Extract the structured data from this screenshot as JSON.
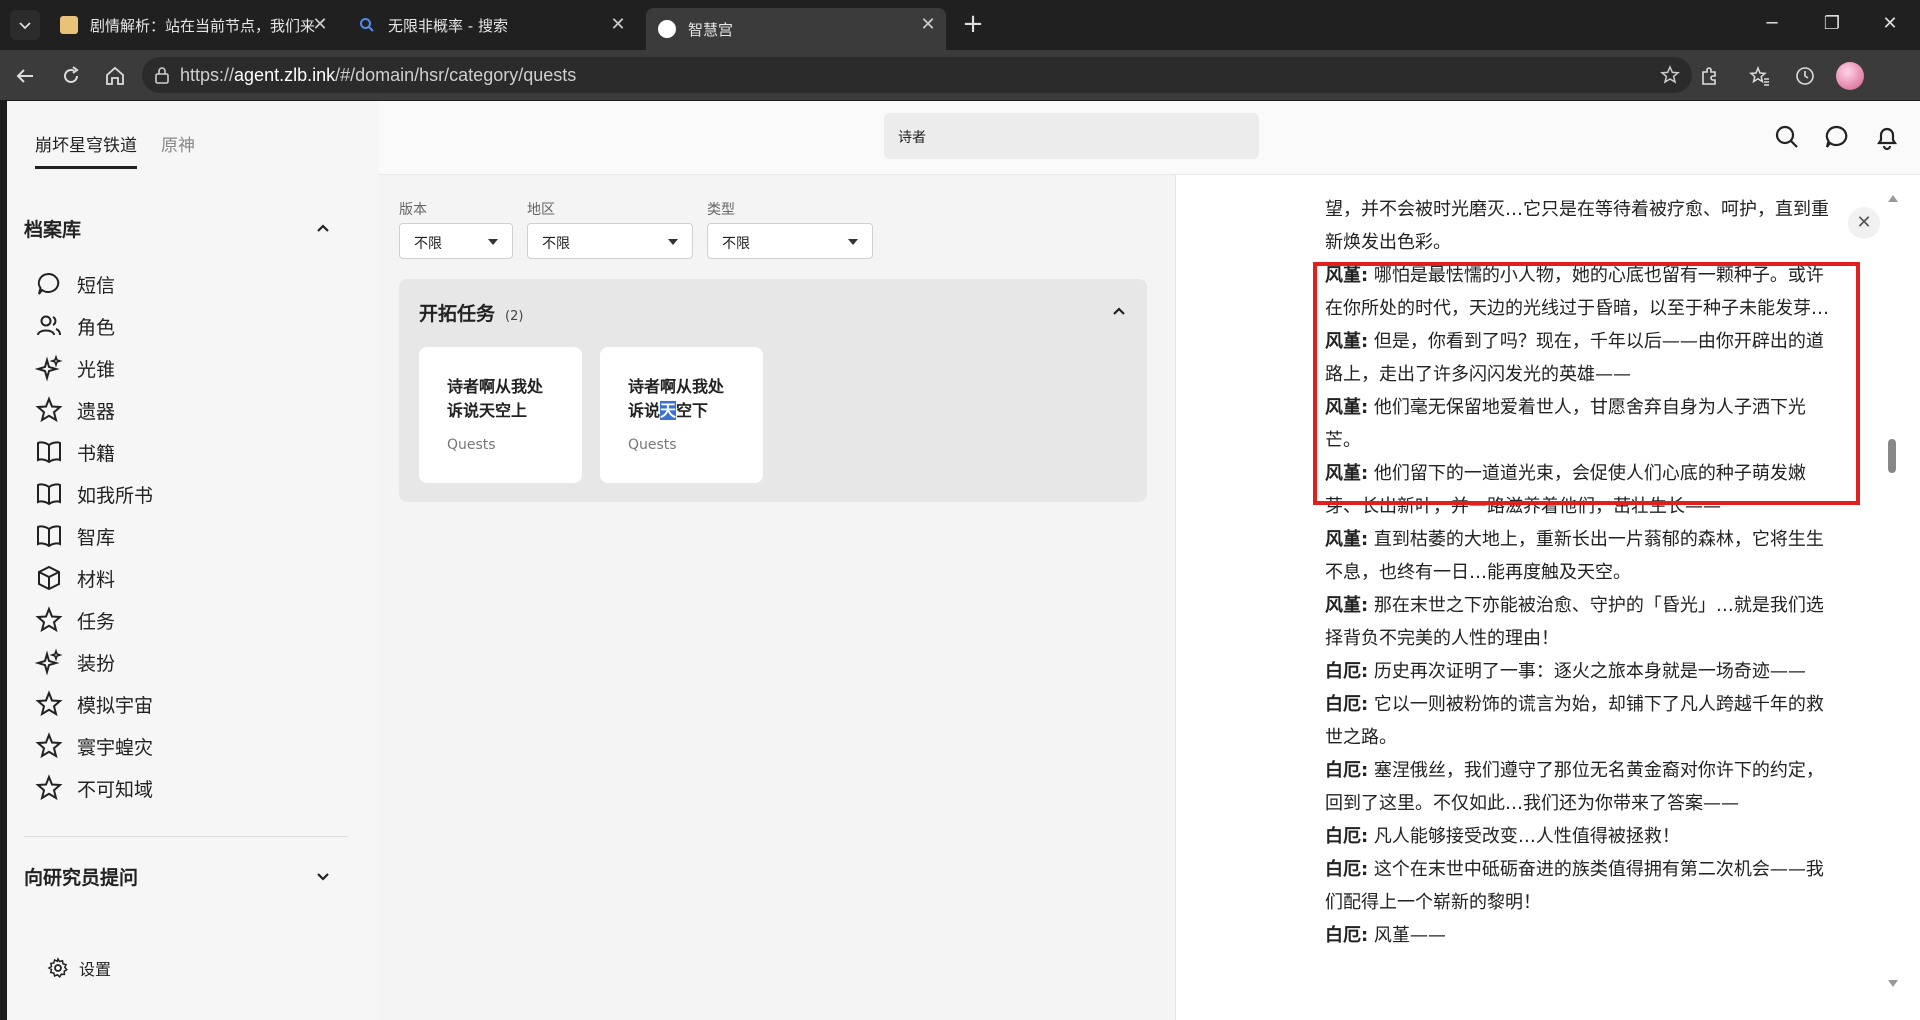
{
  "browser": {
    "tabs": [
      {
        "title": "剧情解析：站在当前节点，我们来",
        "active": false
      },
      {
        "title": "无限非概率 - 搜索",
        "active": false
      },
      {
        "title": "智慧宫",
        "active": true
      }
    ],
    "url_prefix": "https://",
    "url_host": "agent.zlb.ink",
    "url_path": "/#/domain/hsr/category/quests"
  },
  "sidebar": {
    "game_tabs": [
      "崩坏星穹铁道",
      "原神"
    ],
    "archive_title": "档案库",
    "items": [
      {
        "label": "短信",
        "icon": "message-icon"
      },
      {
        "label": "角色",
        "icon": "users-icon"
      },
      {
        "label": "光锥",
        "icon": "sparkles-icon"
      },
      {
        "label": "遗器",
        "icon": "star-icon"
      },
      {
        "label": "书籍",
        "icon": "book-icon"
      },
      {
        "label": "如我所书",
        "icon": "book-icon"
      },
      {
        "label": "智库",
        "icon": "book-icon"
      },
      {
        "label": "材料",
        "icon": "box-icon"
      },
      {
        "label": "任务",
        "icon": "star-icon"
      },
      {
        "label": "装扮",
        "icon": "sparkles-icon"
      },
      {
        "label": "模拟宇宙",
        "icon": "star-icon"
      },
      {
        "label": "寰宇蝗灾",
        "icon": "star-icon"
      },
      {
        "label": "不可知域",
        "icon": "star-icon"
      }
    ],
    "ask_title": "向研究员提问",
    "settings_label": "设置"
  },
  "topbar": {
    "search_value": "诗者"
  },
  "filters": [
    {
      "label": "版本",
      "value": "不限"
    },
    {
      "label": "地区",
      "value": "不限"
    },
    {
      "label": "类型",
      "value": "不限"
    }
  ],
  "panel": {
    "title": "开拓任务",
    "count": "(2)",
    "cards": [
      {
        "title": "诗者啊从我处诉说天空上",
        "sub": "Quests"
      },
      {
        "title_a": "诗者啊从我处诉说",
        "title_hl": "天",
        "title_b": "空下",
        "sub": "Quests"
      }
    ]
  },
  "reader": {
    "lines": [
      {
        "speaker": "",
        "text": "望，并不会被时光磨灭…它只是在等待着被疗愈、呵护，直到重新焕发出色彩。"
      },
      {
        "speaker": "风堇:",
        "text": " 哪怕是最怯懦的小人物，她的心底也留有一颗种子。或许在你所处的时代，天边的光线过于昏暗，以至于种子未能发芽…"
      },
      {
        "speaker": "风堇:",
        "text": " 但是，你看到了吗？现在，千年以后——由你开辟出的道路上，走出了许多闪闪发光的英雄——"
      },
      {
        "speaker": "风堇:",
        "text": " 他们毫无保留地爱着世人，甘愿舍弃自身为人子洒下光芒。"
      },
      {
        "speaker": "风堇:",
        "text": " 他们留下的一道道光束，会促使人们心底的种子萌发嫩芽、长出新叶，并一路滋养着他们，茁壮生长——"
      },
      {
        "speaker": "风堇:",
        "text": " 直到枯萎的大地上，重新长出一片蓊郁的森林，它将生生不息，也终有一日…能再度触及天空。"
      },
      {
        "speaker": "风堇:",
        "text": " 那在末世之下亦能被治愈、守护的「昏光」…就是我们选择背负不完美的人性的理由！"
      },
      {
        "speaker": "白厄:",
        "text": " 历史再次证明了一事：逐火之旅本身就是一场奇迹——"
      },
      {
        "speaker": "白厄:",
        "text": " 它以一则被粉饰的谎言为始，却铺下了凡人跨越千年的救世之路。"
      },
      {
        "speaker": "白厄:",
        "text": " 塞涅俄丝，我们遵守了那位无名黄金裔对你许下的约定，回到了这里。不仅如此…我们还为你带来了答案——"
      },
      {
        "speaker": "白厄:",
        "text": " 凡人能够接受改变…人性值得被拯救！"
      },
      {
        "speaker": "白厄:",
        "text": " 这个在末世中砥砺奋进的族类值得拥有第二次机会——我们配得上一个崭新的黎明！"
      },
      {
        "speaker": "白厄:",
        "text": " 风堇——"
      }
    ]
  }
}
